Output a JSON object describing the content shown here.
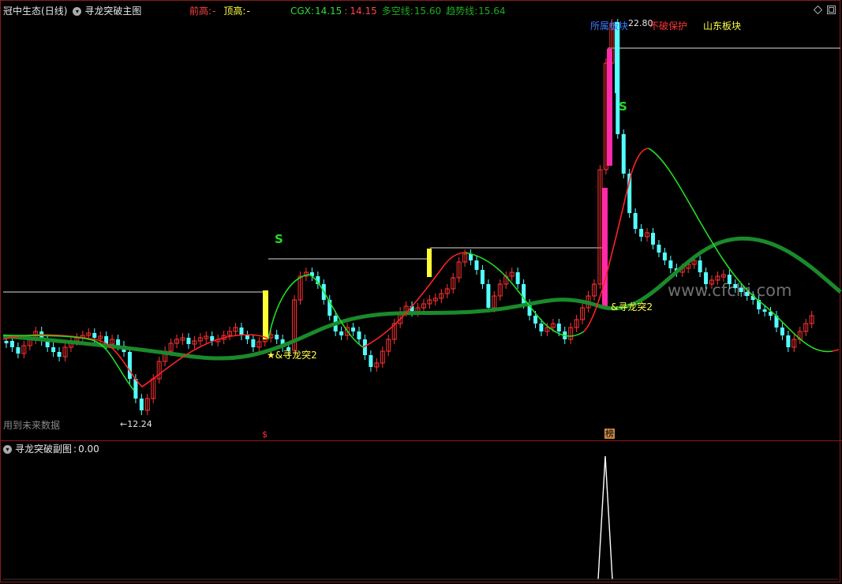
{
  "main_header": {
    "stock_name": "冠中生态",
    "period": "(日线)",
    "indicator_name": "寻龙突破主图",
    "front_high_label": "前高:",
    "front_high_value": "-",
    "top_high_label": "顶高:",
    "top_high_value": "-",
    "cgx_label": "CGX:",
    "cgx_value": "14.15",
    "cgx_value2": "14.15",
    "long_short_label": "多空线:",
    "long_short_value": "15.60",
    "trend_label": "趋势线:",
    "trend_value": "15.64"
  },
  "main_annotations": {
    "sector_label": "所属板块",
    "stop_loss_label": "不破保护",
    "province_label": "山东板块",
    "high_price": "22.80",
    "low_price": "12.24",
    "signal_s1": "S",
    "signal_s2": "S",
    "breakout_label_1": "★&寻龙突2",
    "breakout_label_2": "&寻龙突2",
    "future_data_note": "用到未来数据",
    "bottom_marker_1": "$",
    "bottom_marker_2": "榜",
    "watermark": "www.cfchi.com"
  },
  "sub_header": {
    "indicator_name": "寻龙突破副图",
    "value_label": ":",
    "value": "0.00"
  },
  "colors": {
    "up_candle": "#ff3333",
    "down_candle": "#54ffff",
    "trend_line": "#1a8a2a",
    "long_line_up": "#ff2222",
    "long_line_down": "#22dd22",
    "signal_yellow": "#ffff33",
    "signal_magenta": "#ff2aa8",
    "frame": "#8a1a1a",
    "resistance_line": "#dddddd"
  },
  "icons": [
    "toggle-icon",
    "diamond-icon",
    "window-icon"
  ]
}
